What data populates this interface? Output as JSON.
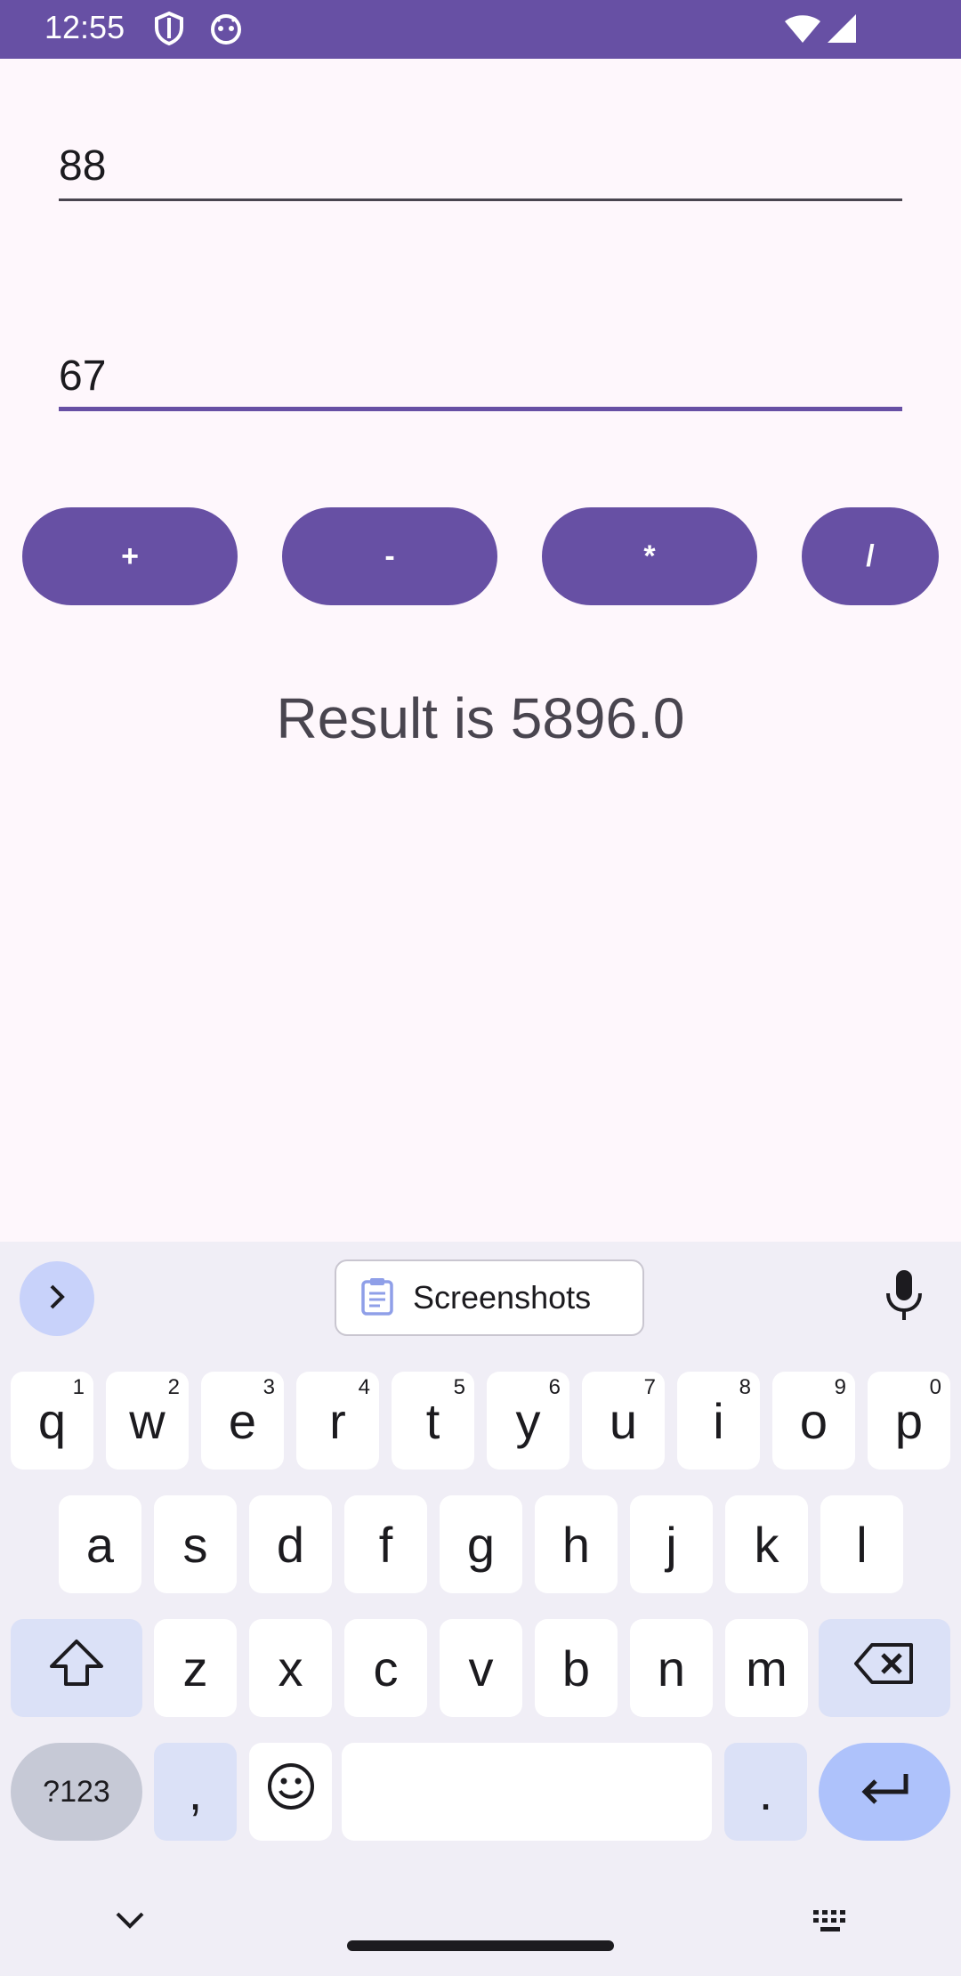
{
  "status_bar": {
    "time": "12:55",
    "icons": [
      "shield-icon",
      "android-icon",
      "wifi-icon",
      "signal-icon"
    ]
  },
  "form": {
    "first_number": "88",
    "second_number": "67"
  },
  "operations": [
    "+",
    "-",
    "*",
    "/"
  ],
  "result_text": "Result is 5896.0",
  "keyboard": {
    "suggestion_chip": "Screenshots",
    "row1": [
      {
        "key": "q",
        "hint": "1"
      },
      {
        "key": "w",
        "hint": "2"
      },
      {
        "key": "e",
        "hint": "3"
      },
      {
        "key": "r",
        "hint": "4"
      },
      {
        "key": "t",
        "hint": "5"
      },
      {
        "key": "y",
        "hint": "6"
      },
      {
        "key": "u",
        "hint": "7"
      },
      {
        "key": "i",
        "hint": "8"
      },
      {
        "key": "o",
        "hint": "9"
      },
      {
        "key": "p",
        "hint": "0"
      }
    ],
    "row2": [
      "a",
      "s",
      "d",
      "f",
      "g",
      "h",
      "j",
      "k",
      "l"
    ],
    "row3": [
      "z",
      "x",
      "c",
      "v",
      "b",
      "n",
      "m"
    ],
    "symbols_key": "?123",
    "comma_key": ",",
    "period_key": "."
  },
  "colors": {
    "primary": "#6750a4",
    "background": "#fef7fc",
    "keyboard_bg": "#f0eef6",
    "enter_key": "#aec2fb"
  }
}
